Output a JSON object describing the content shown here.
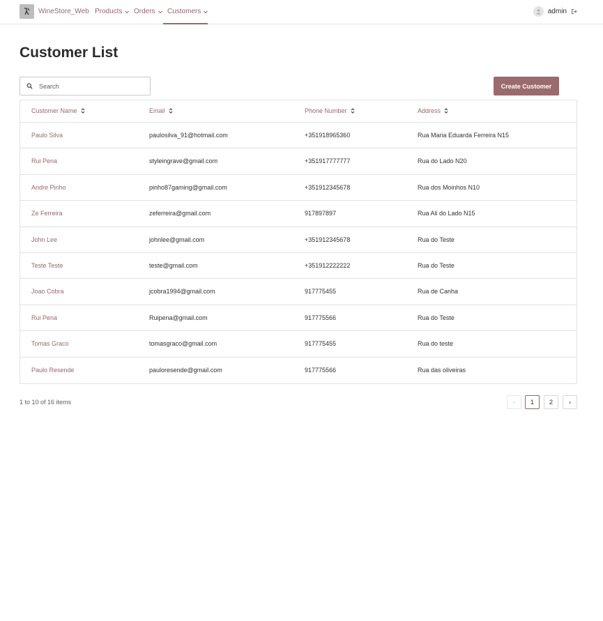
{
  "nav": {
    "brand": "WineStore_Web",
    "items": [
      {
        "label": "Products"
      },
      {
        "label": "Orders"
      },
      {
        "label": "Customers"
      }
    ],
    "user": "admin"
  },
  "page": {
    "title": "Customer List",
    "search_placeholder": "Search",
    "create_label": "Create Customer"
  },
  "table": {
    "columns": [
      "Customer Name",
      "Email",
      "Phone Number",
      "Address"
    ],
    "rows": [
      {
        "name": "Paulo Silva",
        "email": "paulosilva_91@hotmail.com",
        "phone": "+351918965360",
        "address": "Rua Maria Eduarda Ferreira N15"
      },
      {
        "name": "Rui  Pena",
        "email": "styleingrave@gmail.com",
        "phone": "+351917777777",
        "address": "Rua do Lado N20"
      },
      {
        "name": "Andre Pinho",
        "email": "pinho87gaming@gmail.com",
        "phone": "+351912345678",
        "address": "Rua dos Moinhos N10"
      },
      {
        "name": "Ze Ferreira",
        "email": "zeferreira@gmail.com",
        "phone": "917897897",
        "address": "Rua Ali do Lado N15"
      },
      {
        "name": "John  Lee",
        "email": "johnlee@gmail.com",
        "phone": "+351912345678",
        "address": "Rua do Teste"
      },
      {
        "name": "Teste Teste",
        "email": "teste@gmail.com",
        "phone": "+351912222222",
        "address": "Rua do Teste"
      },
      {
        "name": "Joao Cobra",
        "email": "jcobra1994@gmail.com",
        "phone": "917775455",
        "address": "Rua de Canha"
      },
      {
        "name": "Rui  Pena",
        "email": "Ruipena@gmail.com",
        "phone": "917775566",
        "address": "Rua do Teste"
      },
      {
        "name": "Tomas Graco",
        "email": "tomasgraco@gmail.com",
        "phone": "917775455",
        "address": "Rua do teste"
      },
      {
        "name": "Paulo Resende",
        "email": "pauloresende@gmail.com",
        "phone": "917775566",
        "address": "Rua das oliveiras"
      }
    ]
  },
  "footer": {
    "items_text": "1 to 10 of 16 items",
    "pages": [
      "1",
      "2"
    ],
    "current_page": "1",
    "prev_icon": "‹",
    "next_icon": "›"
  },
  "colors": {
    "accent": "#96686b",
    "button": "#9a6b6e"
  }
}
